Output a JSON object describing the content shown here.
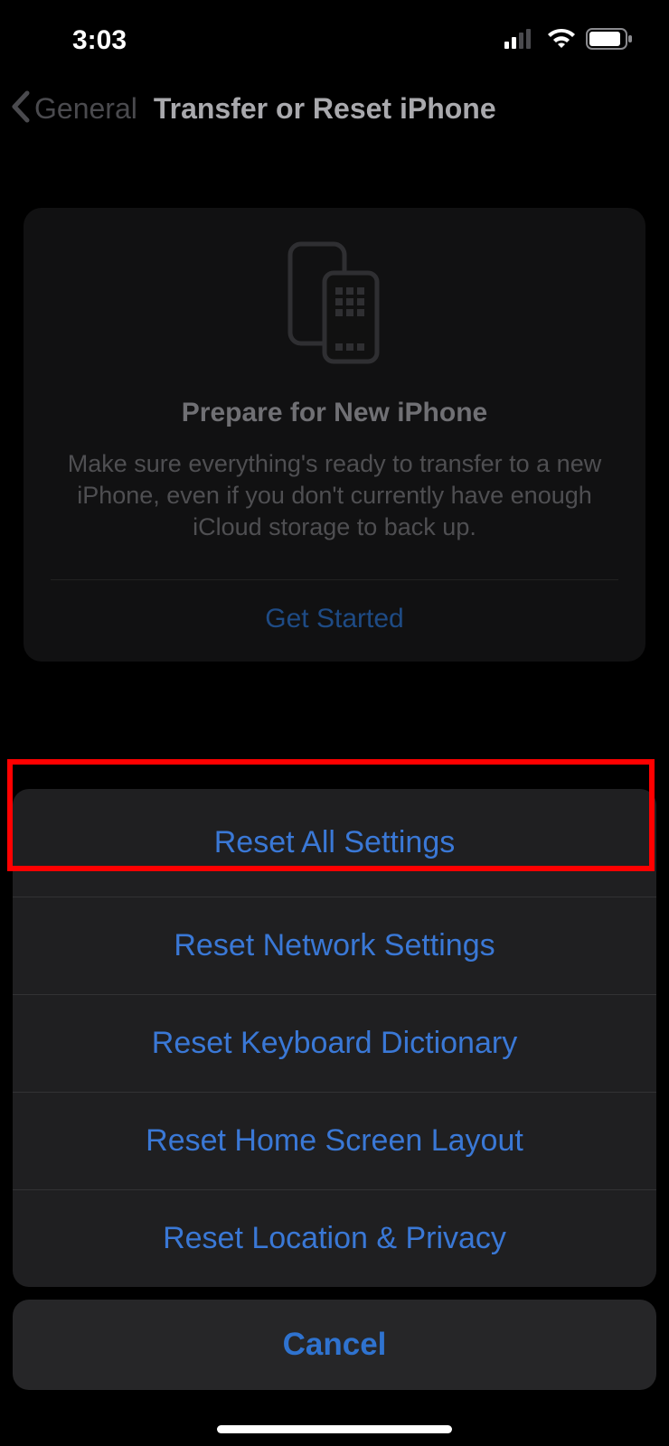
{
  "status": {
    "time": "3:03"
  },
  "nav": {
    "back_label": "General",
    "title": "Transfer or Reset iPhone"
  },
  "prepare_card": {
    "title": "Prepare for New iPhone",
    "description": "Make sure everything's ready to transfer to a new iPhone, even if you don't currently have enough iCloud storage to back up.",
    "cta": "Get Started"
  },
  "reset_sheet": {
    "items": [
      "Reset All Settings",
      "Reset Network Settings",
      "Reset Keyboard Dictionary",
      "Reset Home Screen Layout",
      "Reset Location & Privacy"
    ],
    "cancel": "Cancel"
  },
  "highlight": {
    "target_index": 0
  }
}
